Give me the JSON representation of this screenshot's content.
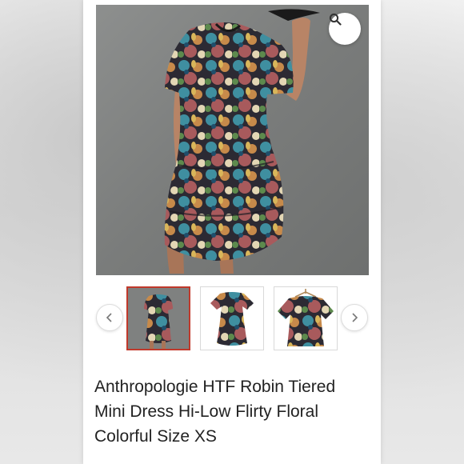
{
  "product": {
    "title": "Anthropologie HTF Robin Tiered Mini Dress Hi-Low Flirty Floral Colorful Size XS"
  },
  "gallery": {
    "zoom_icon": "magnifier-icon",
    "prev_icon": "chevron-left-icon",
    "next_icon": "chevron-right-icon",
    "thumbnail_count": 3,
    "selected_thumbnail": 1
  },
  "colors": {
    "selected_border": "#c0392b",
    "photo_background": "#7f8180",
    "text": "#222222"
  }
}
